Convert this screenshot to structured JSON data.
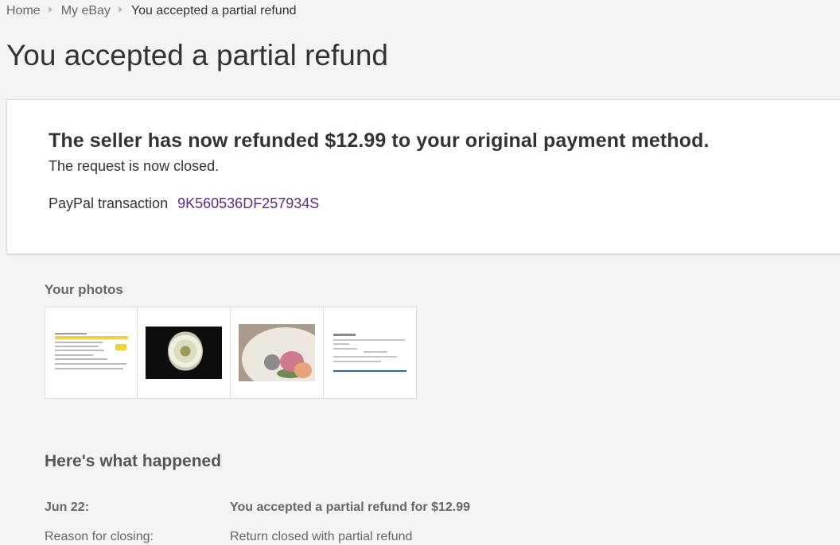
{
  "breadcrumb": {
    "home": "Home",
    "my_ebay": "My eBay",
    "current": "You accepted a partial refund"
  },
  "page_title": "You accepted a partial refund",
  "status_card": {
    "headline": "The seller has now refunded $12.99 to your original payment method.",
    "subtext": "The request is now closed.",
    "paypal_label": "PayPal transaction",
    "paypal_id": "9K560536DF257934S",
    "link_color": "#5b2a8c"
  },
  "photos": {
    "heading": "Your photos",
    "items": [
      {
        "kind": "document-screenshot"
      },
      {
        "kind": "basket-photo"
      },
      {
        "kind": "plate-photo"
      },
      {
        "kind": "form-screenshot"
      }
    ]
  },
  "history": {
    "heading": "Here's what happened",
    "events": [
      {
        "label": "Jun 22:",
        "value": "You accepted a partial refund for $12.99"
      },
      {
        "label": "Reason for closing:",
        "value": "Return closed with partial refund"
      }
    ]
  }
}
